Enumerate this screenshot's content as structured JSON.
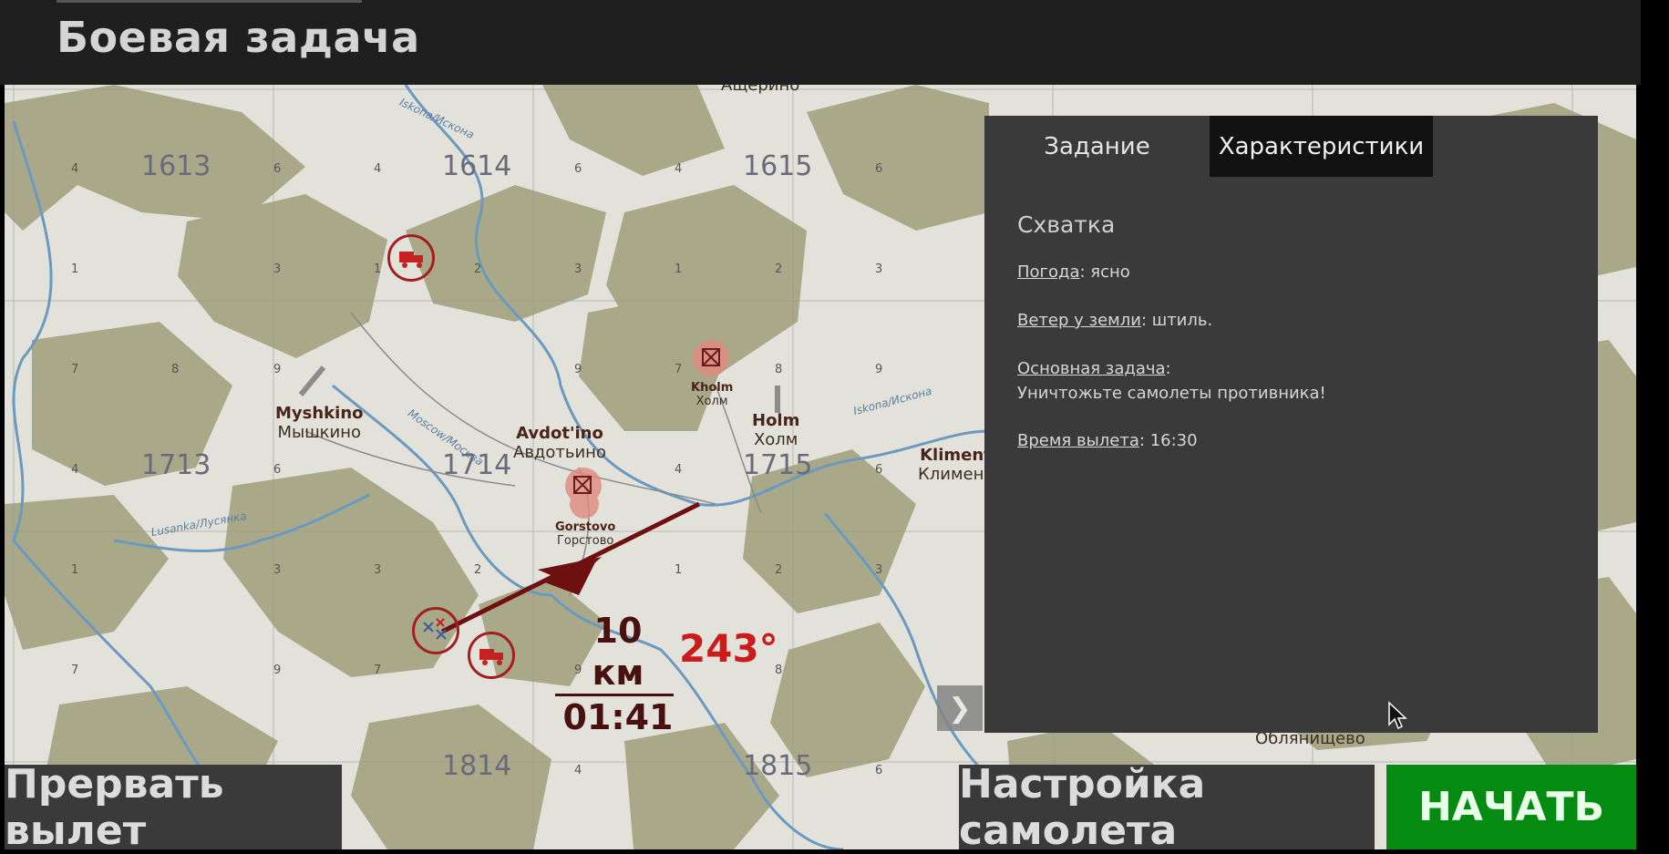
{
  "header": {
    "title": "Боевая задача"
  },
  "map": {
    "grid_labels": [
      "1613",
      "1614",
      "1615",
      "1713",
      "1714",
      "1715",
      "1814",
      "1815"
    ],
    "sub_labels": [
      "4",
      "6",
      "4",
      "6",
      "4",
      "6",
      "1",
      "3",
      "1",
      "2",
      "3",
      "1",
      "2",
      "3",
      "7",
      "9",
      "8",
      "9",
      "7",
      "8",
      "9",
      "4",
      "6",
      "4",
      "6",
      "1",
      "3",
      "2",
      "3",
      "1",
      "2",
      "3",
      "7",
      "9",
      "7",
      "9",
      "8",
      "4",
      "6",
      "4",
      "6"
    ],
    "towns": [
      {
        "latin": "Myshkino",
        "cyr": "Мышкино"
      },
      {
        "latin": "Avdot'ino",
        "cyr": "Авдотьино"
      },
      {
        "latin": "Holm",
        "cyr": "Холм"
      },
      {
        "latin": "Kliment",
        "cyr": "Климент"
      },
      {
        "latin": "Kholm",
        "cyr": "Холм"
      },
      {
        "latin": "Gorstovo",
        "cyr": "Горстово"
      },
      {
        "latin": "",
        "cyr": "Ащерино"
      },
      {
        "latin": "",
        "cyr": "Облянищево"
      }
    ],
    "rivers": [
      "Iskona/Искона",
      "Moscow/Москва",
      "Lusanka/Лусянка",
      "Iskona/Искона"
    ],
    "route": {
      "distance": "10 км",
      "time": "01:41",
      "heading": "243°"
    }
  },
  "panel": {
    "tabs": [
      {
        "label": "Задание"
      },
      {
        "label": "Характеристики"
      }
    ],
    "title": "Схватка",
    "weather": {
      "label": "Погода",
      "value": ": ясно"
    },
    "wind": {
      "label": "Ветер у земли",
      "value": ": штиль."
    },
    "objective": {
      "label": "Основная задача",
      "value": "Уничтожьте самолеты противника!"
    },
    "departure": {
      "label": "Время вылета",
      "value": ": 16:30"
    },
    "expand_icon": "chevron-right-icon"
  },
  "buttons": {
    "abort": "Прервать вылет",
    "plane_setup": "Настройка самолета",
    "start": "НАЧАТЬ"
  },
  "colors": {
    "accent_green": "#058a12",
    "marker_red": "#a31f1f",
    "heading_red": "#c91c1c"
  }
}
